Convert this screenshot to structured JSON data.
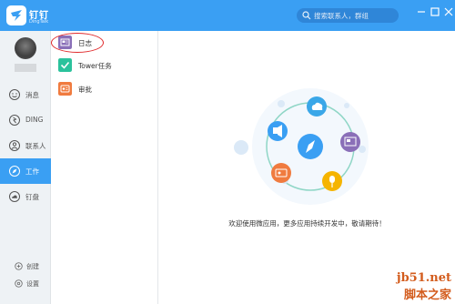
{
  "app": {
    "name": "钉钉",
    "subtitle": "DingTalk"
  },
  "search": {
    "placeholder": "搜索联系人，群组"
  },
  "nav": {
    "items": [
      {
        "label": "消息",
        "icon": "smile-icon"
      },
      {
        "label": "DING",
        "icon": "ding-icon"
      },
      {
        "label": "联系人",
        "icon": "contacts-icon"
      },
      {
        "label": "工作",
        "icon": "compass-icon",
        "active": true
      },
      {
        "label": "钉盘",
        "icon": "cloud-icon"
      }
    ],
    "bottom": [
      {
        "label": "创建",
        "icon": "plus-icon"
      },
      {
        "label": "设置",
        "icon": "gear-icon"
      }
    ]
  },
  "apps": [
    {
      "label": "日志",
      "icon": "log-icon",
      "color": "#8a6fb8"
    },
    {
      "label": "Tower任务",
      "icon": "check-icon",
      "color": "#2bc29c"
    },
    {
      "label": "审批",
      "icon": "approval-icon",
      "color": "#f07b3f"
    }
  ],
  "welcome": "欢迎使用微应用，更多应用持续开发中，敬请期待！",
  "watermark": {
    "line1": "jb51.net",
    "line2": "脚本之家"
  },
  "colors": {
    "brand": "#3a9ff3",
    "highlight": "#e0282a"
  }
}
